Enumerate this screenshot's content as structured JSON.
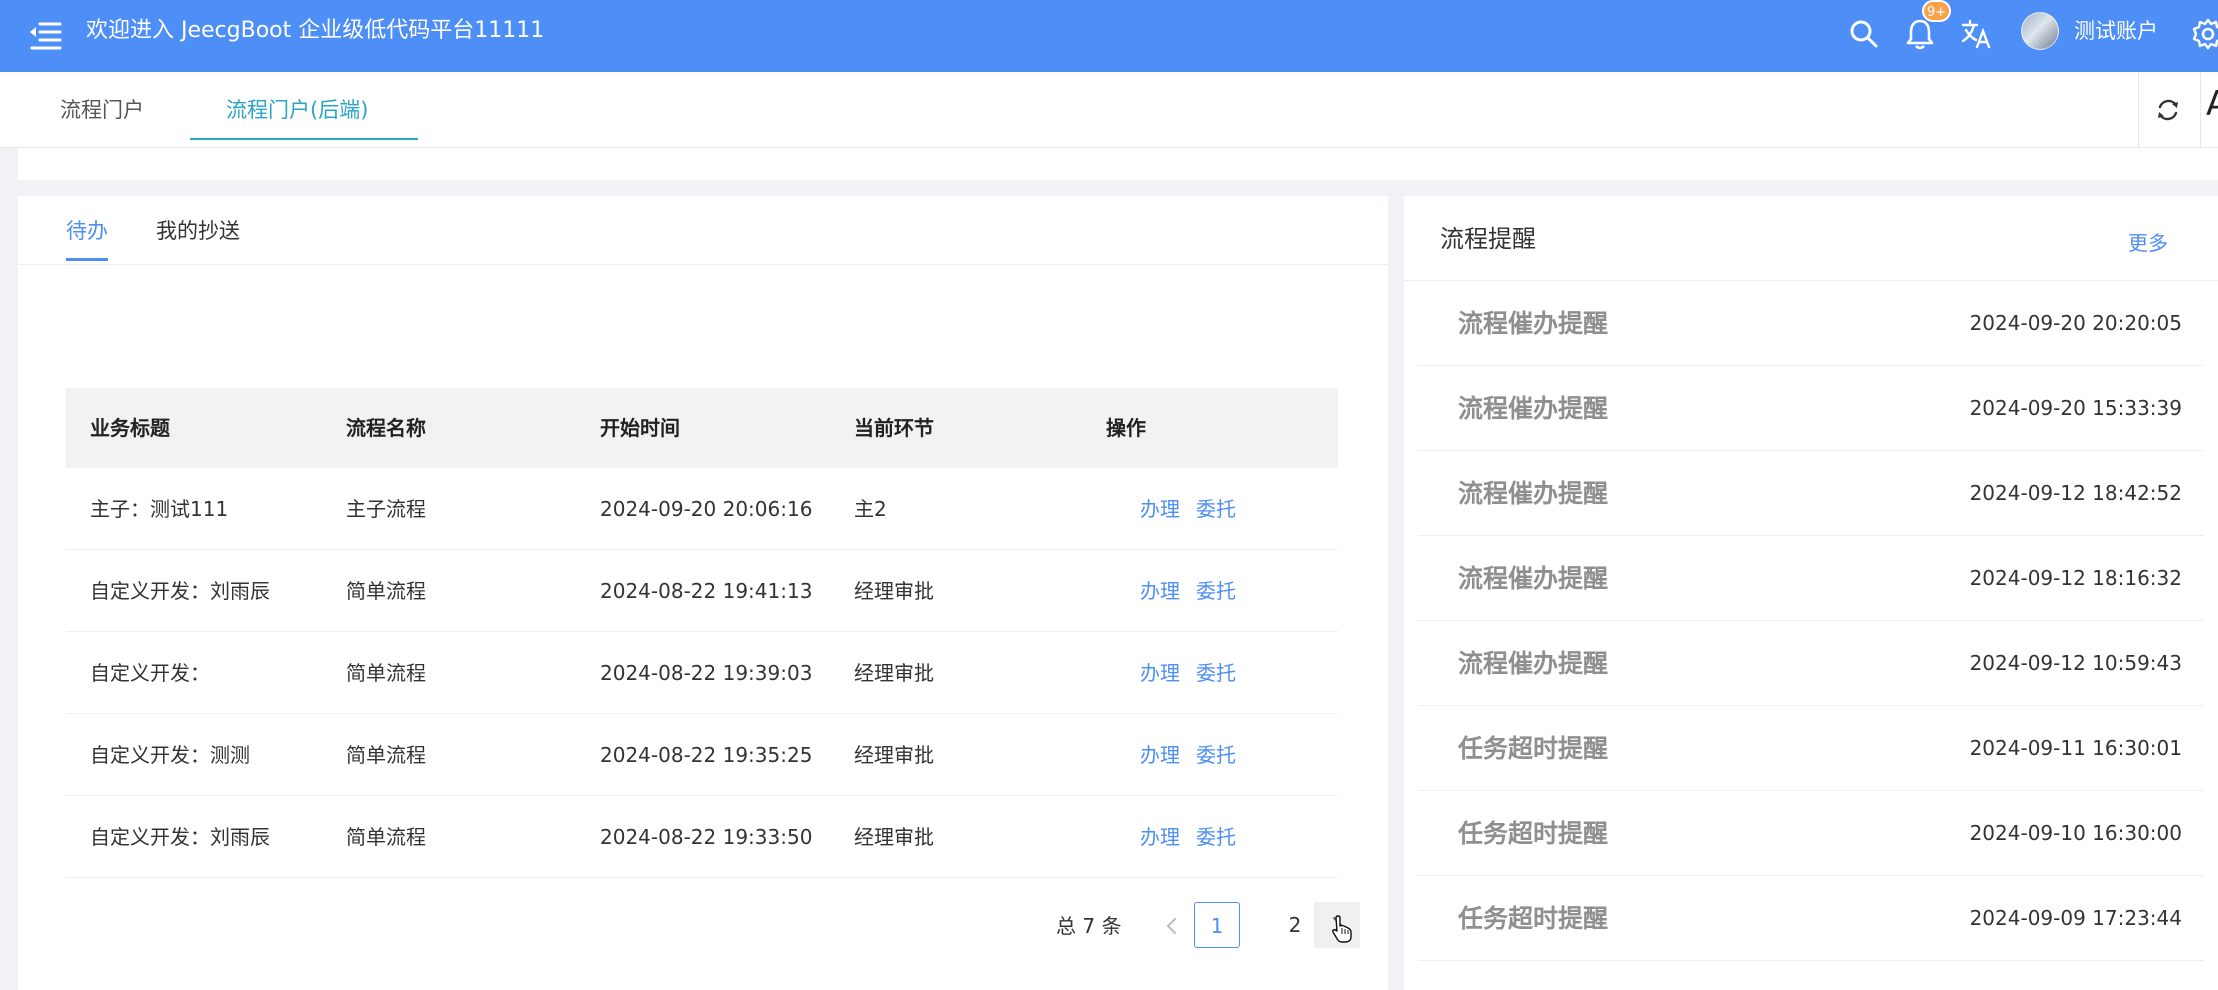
{
  "header": {
    "title": "欢迎进入 JeecgBoot 企业级低代码平台11111",
    "notification_badge": "9+",
    "username": "测试账户",
    "icons": [
      "menu-fold-icon",
      "search-icon",
      "bell-icon",
      "translate-icon",
      "settings-icon"
    ],
    "colors": {
      "header_bg": "#4d8ef7",
      "badge_bg": "#f7a24a"
    }
  },
  "tabs": [
    {
      "label": "流程门户"
    },
    {
      "label": "流程门户(后端)",
      "active": true
    }
  ],
  "tabbar": {
    "more_label": "A"
  },
  "todo": {
    "tabs": [
      {
        "label": "待办",
        "active": true
      },
      {
        "label": "我的抄送"
      }
    ],
    "columns": [
      "业务标题",
      "流程名称",
      "开始时间",
      "当前环节",
      "操作"
    ],
    "rows": [
      {
        "title": "主子：测试111",
        "process": "主子流程",
        "start": "2024-09-20 20:06:16",
        "node": "主2",
        "handle": "办理",
        "delegate": "委托"
      },
      {
        "title": "自定义开发：刘雨辰",
        "process": "简单流程",
        "start": "2024-08-22 19:41:13",
        "node": "经理审批",
        "handle": "办理",
        "delegate": "委托"
      },
      {
        "title": "自定义开发：",
        "process": "简单流程",
        "start": "2024-08-22 19:39:03",
        "node": "经理审批",
        "handle": "办理",
        "delegate": "委托"
      },
      {
        "title": "自定义开发：测测",
        "process": "简单流程",
        "start": "2024-08-22 19:35:25",
        "node": "经理审批",
        "handle": "办理",
        "delegate": "委托"
      },
      {
        "title": "自定义开发：刘雨辰",
        "process": "简单流程",
        "start": "2024-08-22 19:33:50",
        "node": "经理审批",
        "handle": "办理",
        "delegate": "委托"
      }
    ],
    "pagination": {
      "total": "总 7 条",
      "pages": [
        "1",
        "2"
      ],
      "current": "1"
    },
    "colors": {
      "link": "#4d8ef7",
      "thead_bg": "#f2f2f2"
    }
  },
  "reminders": {
    "title": "流程提醒",
    "more": "更多",
    "items": [
      {
        "title": "流程催办提醒",
        "time": "2024-09-20 20:20:05"
      },
      {
        "title": "流程催办提醒",
        "time": "2024-09-20 15:33:39"
      },
      {
        "title": "流程催办提醒",
        "time": "2024-09-12 18:42:52"
      },
      {
        "title": "流程催办提醒",
        "time": "2024-09-12 18:16:32"
      },
      {
        "title": "流程催办提醒",
        "time": "2024-09-12 10:59:43"
      },
      {
        "title": "任务超时提醒",
        "time": "2024-09-11 16:30:01"
      },
      {
        "title": "任务超时提醒",
        "time": "2024-09-10 16:30:00"
      },
      {
        "title": "任务超时提醒",
        "time": "2024-09-09 17:23:44"
      }
    ]
  }
}
